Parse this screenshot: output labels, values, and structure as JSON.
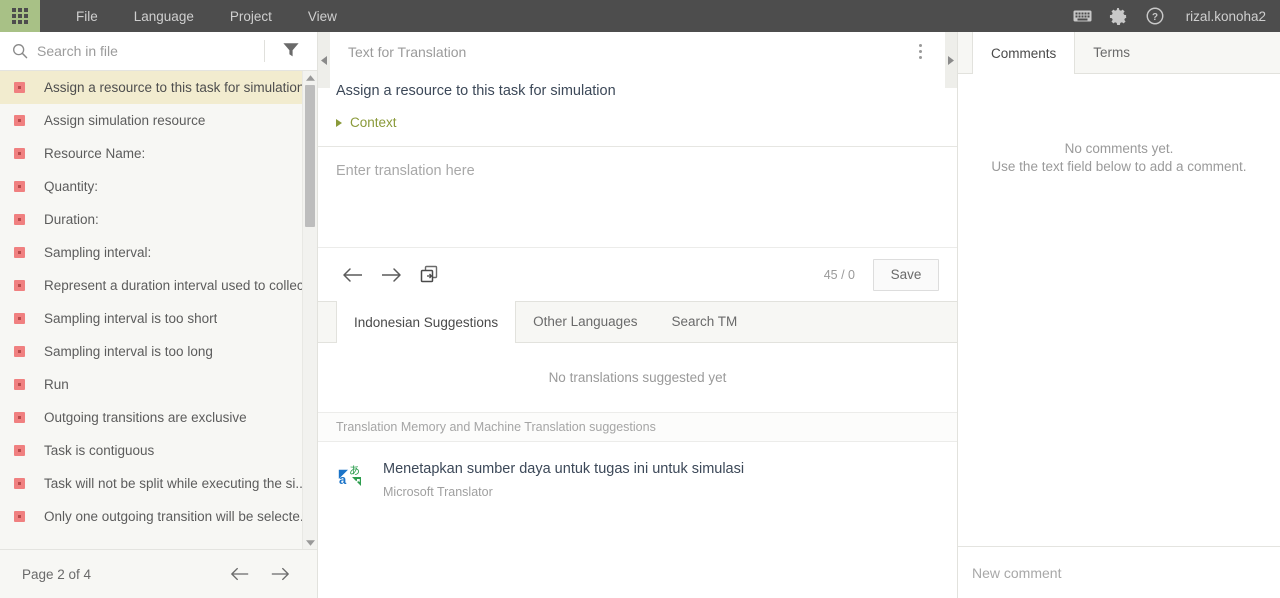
{
  "topbar": {
    "app_grid_icon": "apps-grid-icon",
    "menu": [
      "File",
      "Language",
      "Project",
      "View"
    ],
    "icons": [
      "keyboard-icon",
      "gear-icon",
      "help-icon"
    ],
    "username": "rizal.konoha2",
    "background_color": "#4d4d4d",
    "accent_color": "#a8c186"
  },
  "sidebar": {
    "search": {
      "placeholder": "Search in file",
      "value": "",
      "icon": "search-icon"
    },
    "filter_icon": "filter-icon",
    "segments": [
      {
        "label": "Assign a resource to this task for simulation",
        "active": true
      },
      {
        "label": "Assign simulation resource",
        "active": false
      },
      {
        "label": "Resource Name:",
        "active": false
      },
      {
        "label": "Quantity:",
        "active": false
      },
      {
        "label": "Duration:",
        "active": false
      },
      {
        "label": "Sampling interval:",
        "active": false
      },
      {
        "label": "Represent a duration interval used to collec...",
        "active": false
      },
      {
        "label": "Sampling interval is too short",
        "active": false
      },
      {
        "label": "Sampling interval is too long",
        "active": false
      },
      {
        "label": "Run",
        "active": false
      },
      {
        "label": "Outgoing transitions are exclusive",
        "active": false
      },
      {
        "label": "Task is contiguous",
        "active": false
      },
      {
        "label": "Task will not be split while executing the si...",
        "active": false
      },
      {
        "label": "Only one outgoing transition will be selecte...",
        "active": false
      }
    ],
    "segment_badge_color": "#f08080",
    "active_row_color": "#f2eccf",
    "pager": {
      "label": "Page 2 of 4",
      "prev_icon": "arrow-left-icon",
      "next_icon": "arrow-right-icon"
    }
  },
  "center": {
    "source_header": "Text for Translation",
    "kebab_icon": "more-vertical-icon",
    "collapse_left_icon": "chevron-left-icon",
    "collapse_right_icon": "chevron-right-icon",
    "source_text": "Assign a resource to this task for simulation",
    "context_label": "Context",
    "context_color": "#8a9a3a",
    "target": {
      "placeholder": "Enter translation here",
      "value": ""
    },
    "toolbar": {
      "prev_icon": "arrow-left-icon",
      "next_icon": "arrow-right-icon",
      "copy_icon": "copy-source-icon",
      "char_count": "45 / 0",
      "save_label": "Save"
    },
    "suggestion_tabs": [
      {
        "label": "Indonesian Suggestions",
        "active": true
      },
      {
        "label": "Other Languages",
        "active": false
      },
      {
        "label": "Search TM",
        "active": false
      }
    ],
    "suggestions_empty": "No translations suggested yet",
    "mt_header": "Translation Memory and Machine Translation suggestions",
    "mt_items": [
      {
        "icon": "translate-icon",
        "text": "Menetapkan sumber daya untuk tugas ini untuk simulasi",
        "source": "Microsoft Translator"
      }
    ]
  },
  "right": {
    "tabs": [
      {
        "label": "Comments",
        "active": true
      },
      {
        "label": "Terms",
        "active": false
      }
    ],
    "empty_line1": "No comments yet.",
    "empty_line2": "Use the text field below to add a comment.",
    "new_comment": {
      "placeholder": "New comment",
      "value": ""
    }
  }
}
